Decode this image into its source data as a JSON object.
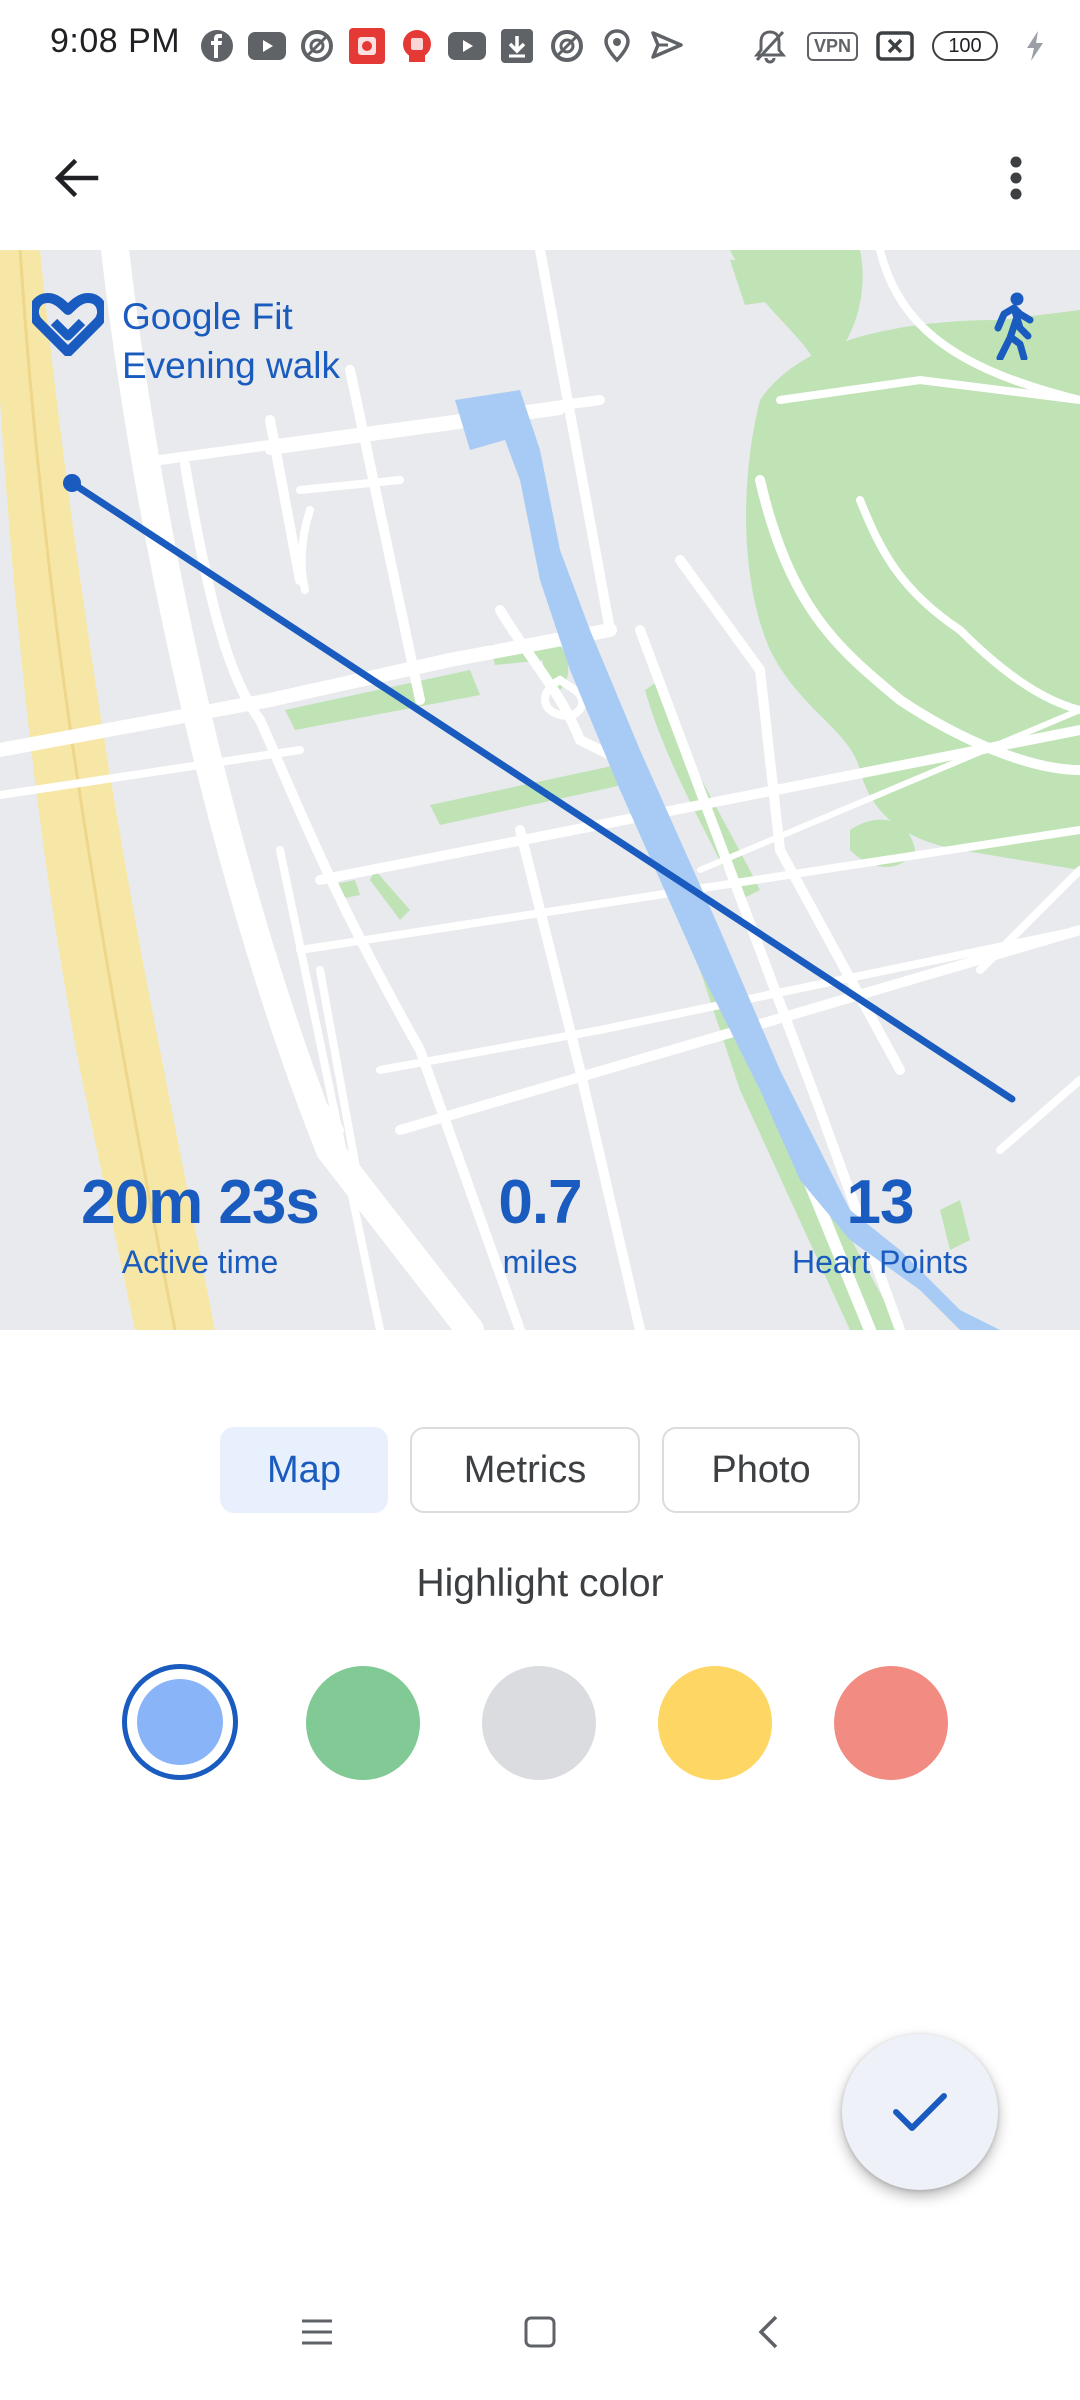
{
  "status_bar": {
    "time": "9:08 PM",
    "left_icons": [
      "facebook-icon",
      "youtube-icon",
      "signal-app-icon",
      "red-app-icon",
      "red-badge-app-icon",
      "youtube-icon",
      "download-icon",
      "signal-app-icon",
      "location-icon",
      "send-icon"
    ],
    "vpn_label": "VPN",
    "battery_level": "100",
    "right_icons": [
      "mute-icon",
      "vpn-icon",
      "sim-off-icon",
      "battery-icon",
      "charging-icon"
    ]
  },
  "app_bar": {
    "back_icon": "arrow-back-icon",
    "menu_icon": "more-vert-icon"
  },
  "share_card": {
    "brand": "Google Fit",
    "activity_title": "Evening walk",
    "activity_icon": "walking-icon",
    "stats": [
      {
        "value": "20m 23s",
        "label": "Active time"
      },
      {
        "value": "0.7",
        "label": "miles"
      },
      {
        "value": "13",
        "label": "Heart Points"
      }
    ],
    "route_color": "#1a5bbf"
  },
  "tabs": [
    {
      "label": "Map",
      "selected": true
    },
    {
      "label": "Metrics",
      "selected": false
    },
    {
      "label": "Photo",
      "selected": false
    }
  ],
  "highlight": {
    "title": "Highlight color",
    "colors": [
      {
        "name": "blue",
        "hex": "#8ab4f8",
        "selected": true
      },
      {
        "name": "green",
        "hex": "#81c995",
        "selected": false
      },
      {
        "name": "grey",
        "hex": "#dadce0",
        "selected": false
      },
      {
        "name": "yellow",
        "hex": "#fdd663",
        "selected": false
      },
      {
        "name": "red",
        "hex": "#f28b82",
        "selected": false
      }
    ]
  },
  "fab": {
    "icon": "check-icon"
  },
  "nav_bar": {
    "icons": [
      "menu-icon",
      "home-square-icon",
      "back-chevron-icon"
    ]
  },
  "colors": {
    "accent": "#1a5bbf",
    "tab_selected_bg": "#e8f0fe"
  }
}
